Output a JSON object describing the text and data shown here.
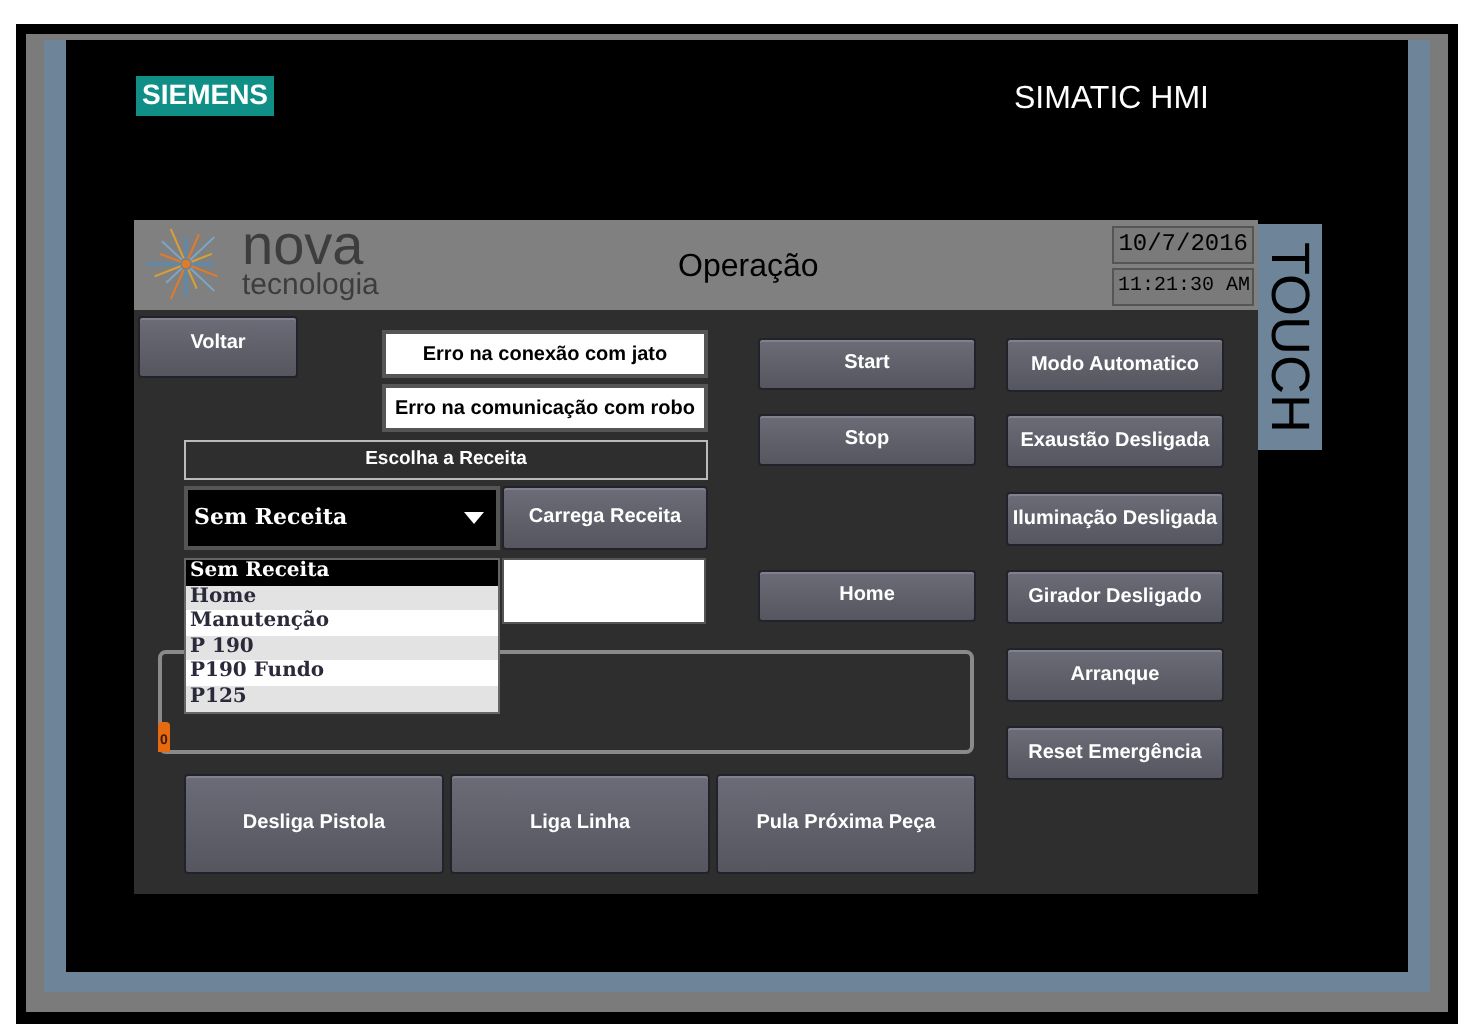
{
  "device": {
    "brand": "SIEMENS",
    "model": "SIMATIC HMI",
    "side_label": "TOUCH"
  },
  "screen": {
    "logo": {
      "line1": "nova",
      "line2": "tecnologia"
    },
    "title": "Operação",
    "date": "10/7/2016",
    "time": "11:21:30 AM",
    "back_button": "Voltar",
    "alarms": [
      "Erro na conexão com jato",
      "Erro na comunicação com robo"
    ],
    "control_buttons": [
      "Start",
      "Stop",
      "Home"
    ],
    "mode_buttons": [
      "Modo Automatico",
      "Exaustão Desligada",
      "Iluminação Desligada",
      "Girador Desligado",
      "Arranque",
      "Reset Emergência"
    ],
    "recipe": {
      "label": "Escolha a Receita",
      "value": "Sem Receita",
      "expanded": true,
      "load_button": "Carrega Receita",
      "options": [
        {
          "label": "Sem Receita",
          "selected": true
        },
        {
          "label": "Home",
          "selected": false
        },
        {
          "label": "Manutenção",
          "selected": false
        },
        {
          "label": "P 190",
          "selected": false
        },
        {
          "label": "P190 Fundo",
          "selected": false
        },
        {
          "label": "P125",
          "selected": false
        }
      ]
    },
    "counter": "0",
    "bottom_buttons": [
      "Desliga Pistola",
      "Liga Linha",
      "Pula Próxima Peça"
    ]
  }
}
